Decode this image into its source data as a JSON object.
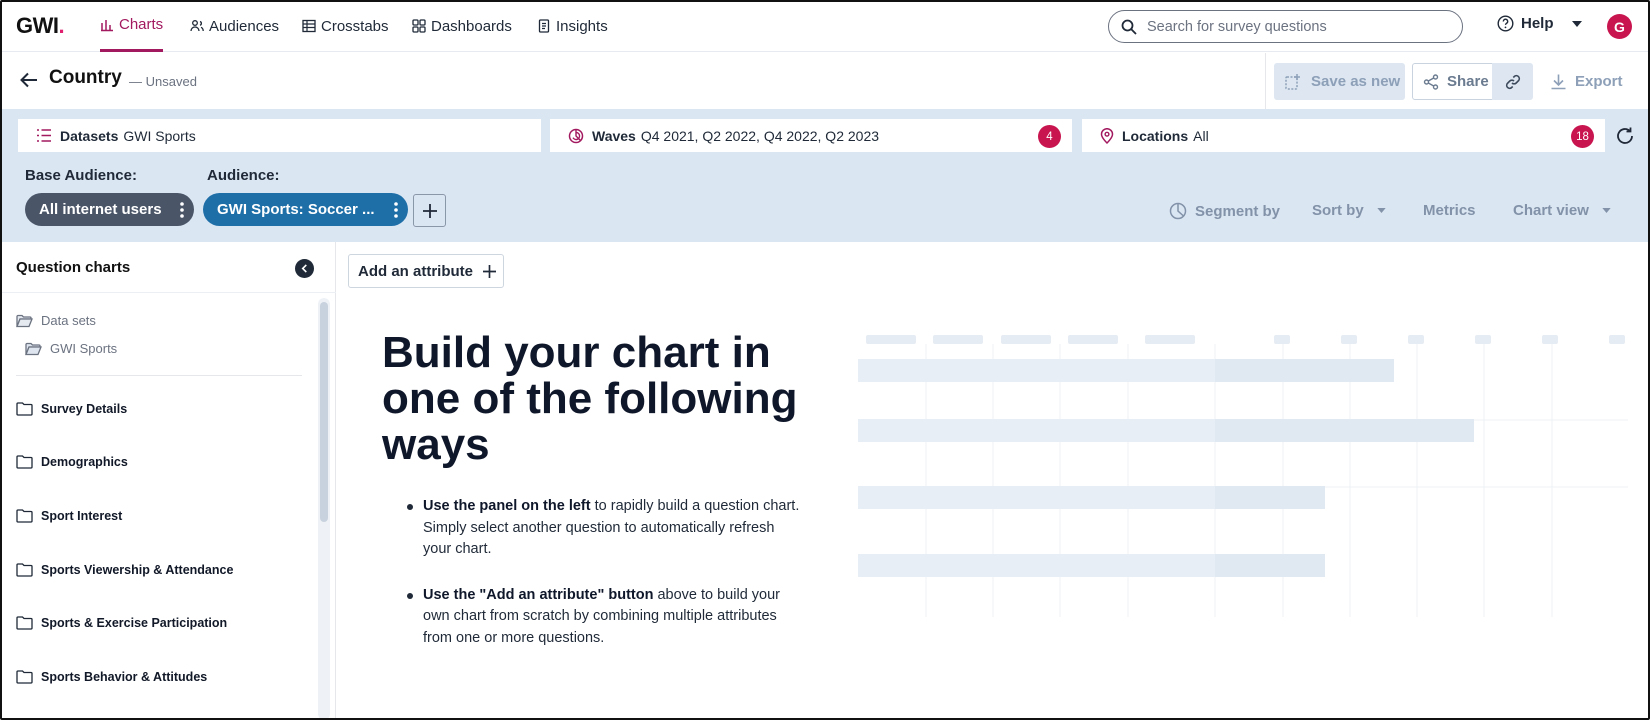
{
  "nav": {
    "logo": "GWI",
    "logo_dot": ".",
    "items": [
      {
        "label": "Charts",
        "icon": "bar-chart-icon",
        "active": true
      },
      {
        "label": "Audiences",
        "icon": "people-icon"
      },
      {
        "label": "Crosstabs",
        "icon": "table-icon"
      },
      {
        "label": "Dashboards",
        "icon": "dashboard-icon"
      },
      {
        "label": "Insights",
        "icon": "document-icon"
      }
    ],
    "search_placeholder": "Search for survey questions",
    "help_label": "Help",
    "avatar_initial": "G"
  },
  "titlebar": {
    "title": "Country",
    "status": "— Unsaved",
    "save_as_new": "Save as new",
    "share": "Share",
    "export": "Export"
  },
  "filters": {
    "datasets_label": "Datasets",
    "datasets_value": "GWI Sports",
    "waves_label": "Waves",
    "waves_value": "Q4 2021, Q2 2022, Q4 2022, Q2 2023",
    "waves_count": "4",
    "locations_label": "Locations",
    "locations_value": "All",
    "locations_count": "18"
  },
  "audience": {
    "base_label": "Base Audience:",
    "audience_label": "Audience:",
    "base_pill": "All internet users",
    "audience_pill": "GWI Sports: Soccer ..."
  },
  "toolbar": {
    "segment_by": "Segment by",
    "sort_by": "Sort by",
    "metrics": "Metrics",
    "chart_view": "Chart view"
  },
  "sidebar": {
    "title": "Question charts",
    "data_sets": "Data sets",
    "dataset_item": "GWI Sports",
    "categories": [
      "Survey Details",
      "Demographics",
      "Sport Interest",
      "Sports Viewership & Attendance",
      "Sports & Exercise Participation",
      "Sports Behavior & Attitudes"
    ]
  },
  "main": {
    "add_attribute": "Add an attribute",
    "headline": "Build your chart in one of the following ways",
    "tip1_bold": "Use the panel on the left",
    "tip1_rest": " to rapidly build a question chart. Simply select another question to automatically refresh your chart.",
    "tip2_bold": "Use the \"Add an attribute\" button",
    "tip2_rest": " above to build your own chart from scratch by combining multiple attributes from one or more questions."
  },
  "colors": {
    "brand": "#a2195f",
    "badge": "#c8154f",
    "band": "#dbe6f3",
    "base_pill": "#4a5568",
    "audience_pill": "#1e6fa8"
  }
}
